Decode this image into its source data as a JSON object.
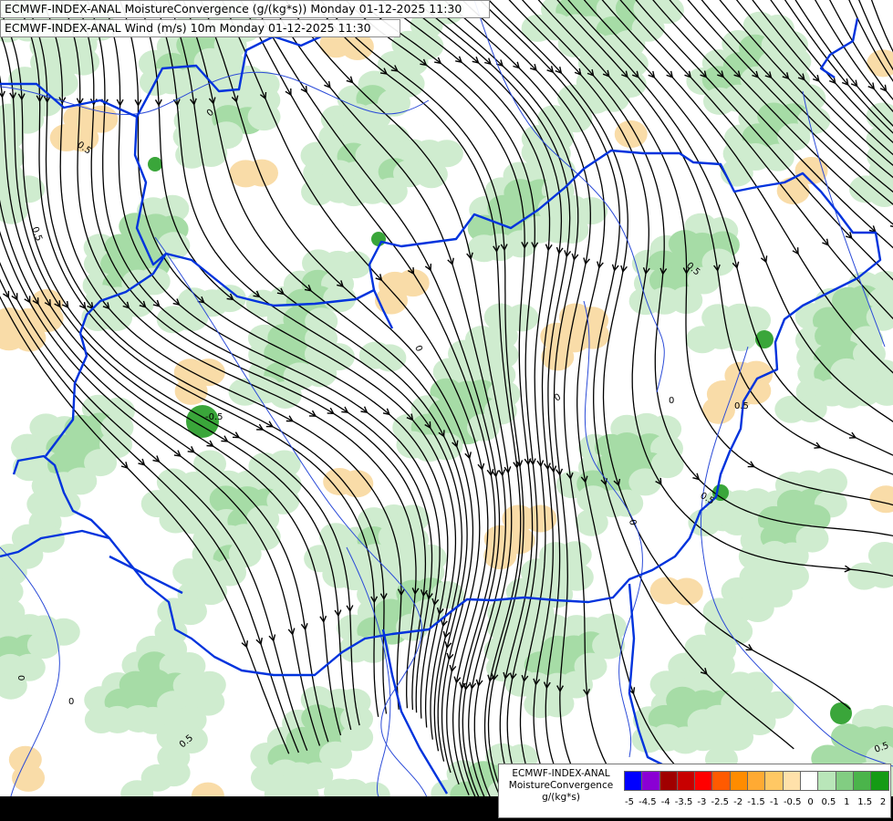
{
  "header": {
    "line1": "ECMWF-INDEX-ANAL MoistureConvergence (g/(kg*s)) Monday 01-12-2025 11:30",
    "line2": "ECMWF-INDEX-ANAL Wind (m/s) 10m Monday 01-12-2025 11:30"
  },
  "legend": {
    "title_line1": "ECMWF-INDEX-ANAL",
    "title_line2": "MoistureConvergence",
    "title_line3": "g/(kg*s)",
    "ticks": [
      "-5",
      "-4.5",
      "-4",
      "-3.5",
      "-3",
      "-2.5",
      "-2",
      "-1.5",
      "-1",
      "-0.5",
      "0",
      "0.5",
      "1",
      "1.5",
      "2"
    ],
    "colors": [
      "#0000ff",
      "#8a00d4",
      "#a00000",
      "#c80000",
      "#ff0000",
      "#ff5a00",
      "#ff8c00",
      "#ffaa33",
      "#ffc864",
      "#ffe1aa",
      "#ffffff",
      "#b9e6b9",
      "#82cd82",
      "#4bb44b",
      "#149b14"
    ]
  },
  "map_labels": {
    "contour_zero": "0",
    "contour_half": "0.5",
    "contour_neg_half": "-0.5"
  },
  "colors": {
    "border": "#0033dd",
    "river": "#2b4bd8",
    "streamline": "#000000",
    "convergence_light": "#cfeccf",
    "convergence_mid": "#a6dca6",
    "convergence_strong": "#3aa63a",
    "divergence_light": "#f9dca8"
  }
}
